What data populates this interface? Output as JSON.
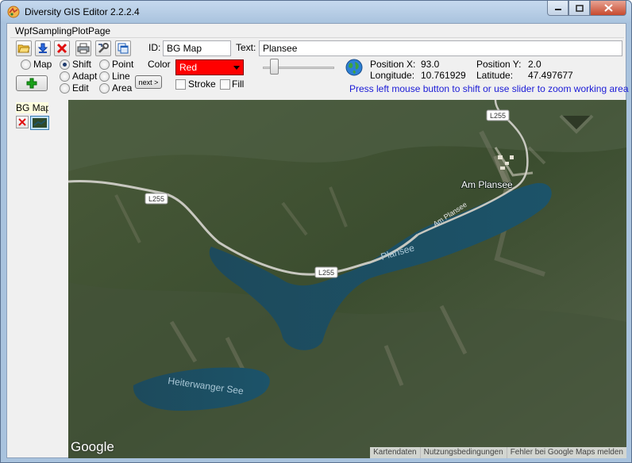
{
  "window": {
    "title": "Diversity GIS Editor 2.2.2.4"
  },
  "page": {
    "label": "WpfSamplingPlotPage"
  },
  "toolbar": {
    "buttons": [
      {
        "name": "open-folder-icon"
      },
      {
        "name": "download-icon"
      },
      {
        "name": "delete-x-icon"
      },
      {
        "name": "printer-icon"
      },
      {
        "name": "tools-icon"
      },
      {
        "name": "window-copy-icon"
      }
    ]
  },
  "fields": {
    "id_label": "ID:",
    "id_value": "BG Map",
    "text_label": "Text:",
    "text_value": "Plansee"
  },
  "modes": {
    "map": "Map",
    "shift": "Shift",
    "adapt": "Adapt",
    "edit": "Edit",
    "point": "Point",
    "line": "Line",
    "area": "Area",
    "selected": "shift"
  },
  "next_label": "next >",
  "color": {
    "label": "Color",
    "value": "Red",
    "swatch": "#ff0000"
  },
  "stroke_label": "Stroke",
  "fill_label": "Fill",
  "zoom_slider": {
    "value": 0.12
  },
  "position": {
    "x_label": "Position X:",
    "x_value": "93.0",
    "y_label": "Position Y:",
    "y_value": "2.0",
    "lon_label": "Longitude:",
    "lon_value": "10.761929",
    "lat_label": "Latitude:",
    "lat_value": "47.497677"
  },
  "hint": "Press left mouse button to shift or use slider to zoom working area",
  "layers": [
    {
      "label": "BG Map"
    }
  ],
  "map": {
    "labels": {
      "lake_main": "Plansee",
      "lake_small": "Heiterwanger See",
      "village": "Am Plansee",
      "road_along": "Am Plansee",
      "road_1": "L255",
      "road_2": "L255",
      "road_3": "L255"
    },
    "logo": "Google",
    "attribution": [
      "Kartendaten",
      "Nutzungsbedingungen",
      "Fehler bei Google Maps melden"
    ]
  }
}
